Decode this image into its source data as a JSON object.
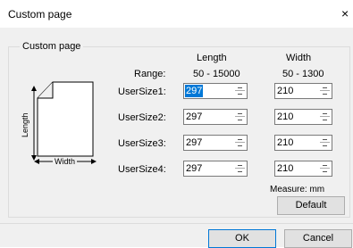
{
  "window": {
    "title": "Custom page",
    "close_glyph": "×"
  },
  "group": {
    "label": "Custom page"
  },
  "headers": {
    "length": "Length",
    "width": "Width"
  },
  "range": {
    "label": "Range:",
    "length": "50  -  15000",
    "width": "50  -  1300"
  },
  "rows": [
    {
      "label": "UserSize1:",
      "length": "297",
      "width": "210"
    },
    {
      "label": "UserSize2:",
      "length": "297",
      "width": "210"
    },
    {
      "label": "UserSize3:",
      "length": "297",
      "width": "210"
    },
    {
      "label": "UserSize4:",
      "length": "297",
      "width": "210"
    }
  ],
  "diagram": {
    "length_label": "Length",
    "width_label": "Width"
  },
  "measure": "Measure: mm",
  "buttons": {
    "default": "Default",
    "ok": "OK",
    "cancel": "Cancel"
  },
  "colors": {
    "selection": "#0078d7",
    "dialog_bg": "#f0f0f0"
  },
  "icons": {
    "close": "close-icon",
    "spinner": "spin-arrows-icon"
  }
}
